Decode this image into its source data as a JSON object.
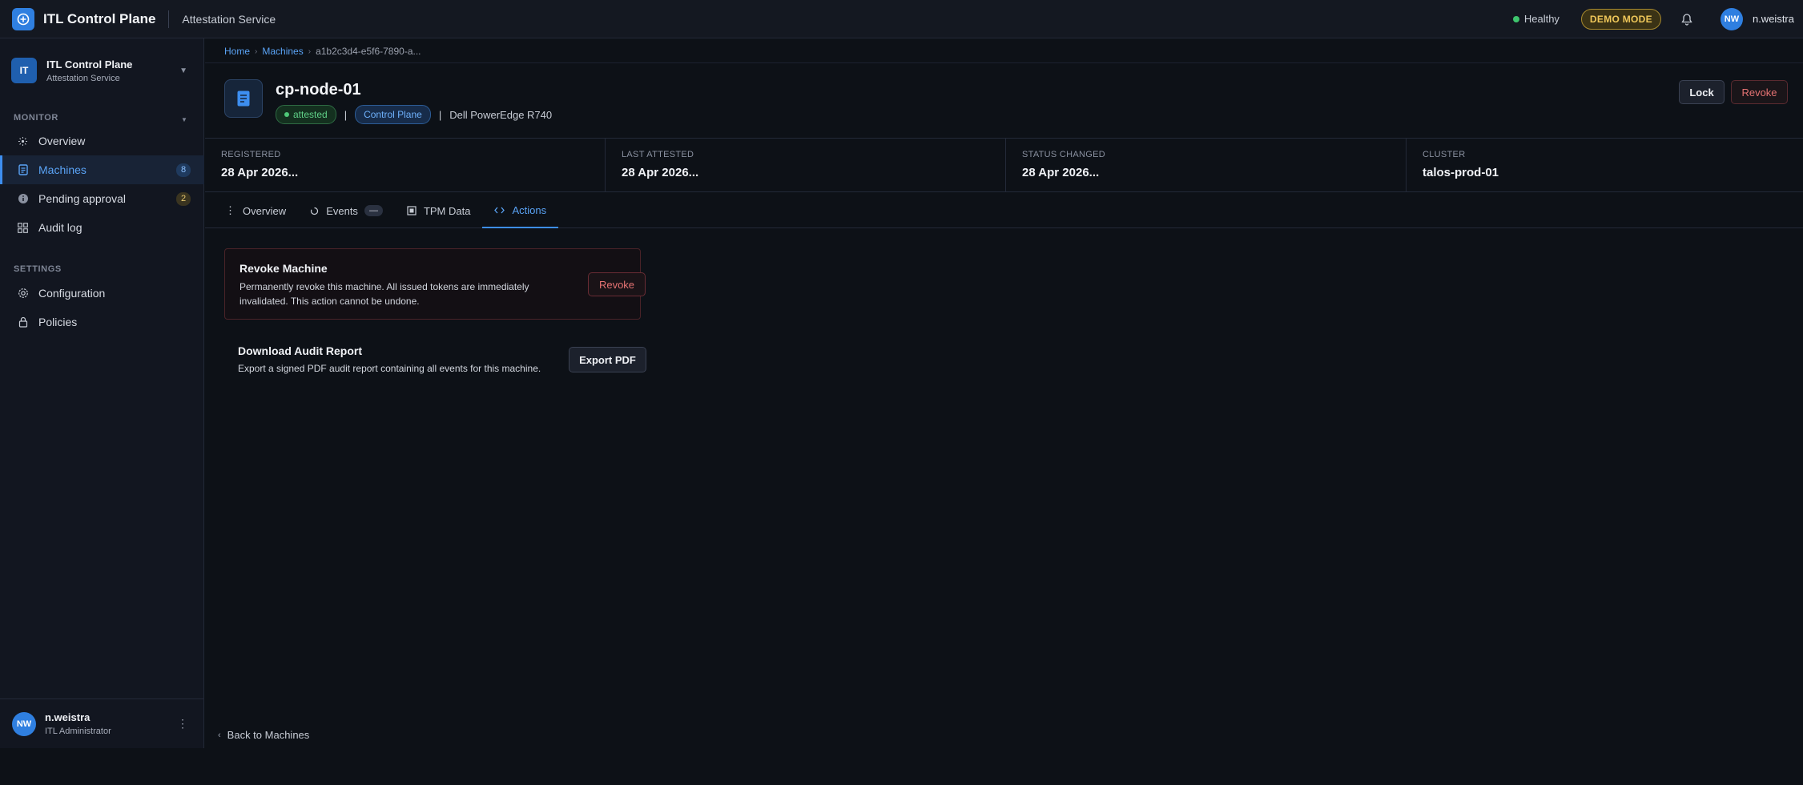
{
  "topbar": {
    "app_title": "ITL Control Plane",
    "subtitle": "Attestation Service",
    "health": "Healthy",
    "demo_badge": "DEMO MODE",
    "user_initials": "NW",
    "user_name": "n.weistra"
  },
  "sidebar": {
    "org_badge": "IT",
    "org_name": "ITL Control Plane",
    "org_sub": "Attestation Service",
    "monitor_heading": "MONITOR",
    "settings_heading": "SETTINGS",
    "monitor_items": [
      {
        "label": "Overview",
        "icon": "overview-icon"
      },
      {
        "label": "Machines",
        "icon": "document-icon",
        "count": "8",
        "active": true
      },
      {
        "label": "Pending approval",
        "icon": "info-icon",
        "count": "2"
      },
      {
        "label": "Audit log",
        "icon": "grid-icon"
      }
    ],
    "settings_items": [
      {
        "label": "Configuration",
        "icon": "gear-icon"
      },
      {
        "label": "Policies",
        "icon": "lock-icon"
      }
    ],
    "footer": {
      "initials": "NW",
      "name": "n.weistra",
      "role": "ITL Administrator"
    }
  },
  "breadcrumb": {
    "home": "Home",
    "machines": "Machines",
    "current": "a1b2c3d4-e5f6-7890-a..."
  },
  "machine": {
    "name": "cp-node-01",
    "status": "attested",
    "role": "Control Plane",
    "model": "Dell PowerEdge R740"
  },
  "header_actions": {
    "lock": "Lock",
    "revoke": "Revoke"
  },
  "stats": [
    {
      "label": "REGISTERED",
      "value": "28 Apr 2026..."
    },
    {
      "label": "LAST ATTESTED",
      "value": "28 Apr 2026..."
    },
    {
      "label": "STATUS CHANGED",
      "value": "28 Apr 2026..."
    },
    {
      "label": "CLUSTER",
      "value": "talos-prod-01"
    }
  ],
  "tabs": {
    "overview": "Overview",
    "events": "Events",
    "events_count": "—",
    "tpm": "TPM Data",
    "actions": "Actions"
  },
  "revoke_card": {
    "title": "Revoke Machine",
    "description": "Permanently revoke this machine. All issued tokens are immediately invalidated. This action cannot be undone.",
    "button": "Revoke"
  },
  "export_card": {
    "title": "Download Audit Report",
    "description": "Export a signed PDF audit report containing all events for this machine.",
    "button": "Export PDF"
  },
  "back_link": "Back to Machines",
  "colors": {
    "accent": "#3d8ef0",
    "danger": "#e57373",
    "success": "#3ec46d",
    "warning": "#f0c85a"
  }
}
